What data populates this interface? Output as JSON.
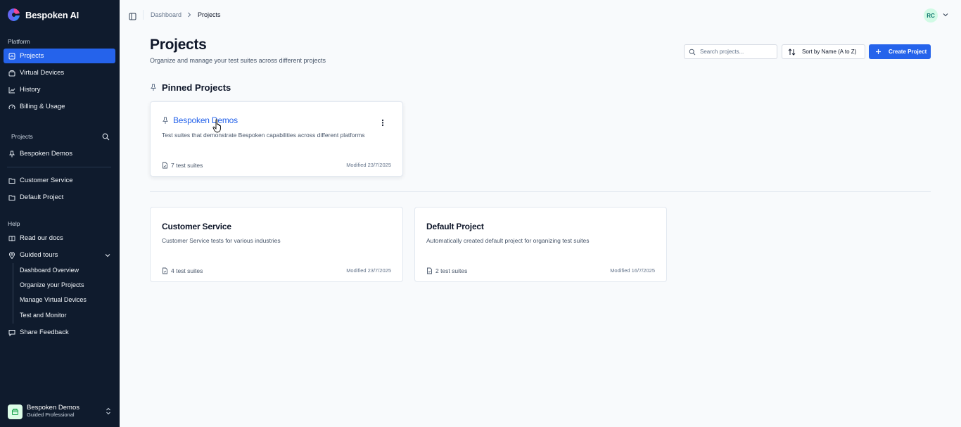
{
  "brand": {
    "name": "Bespoken AI"
  },
  "sidebar": {
    "platform_label": "Platform",
    "platform_items": [
      {
        "label": "Projects",
        "icon": "projects-icon",
        "active": true
      },
      {
        "label": "Virtual Devices",
        "icon": "devices-icon"
      },
      {
        "label": "History",
        "icon": "chart-icon"
      },
      {
        "label": "Billing & Usage",
        "icon": "gauge-icon"
      }
    ],
    "projects_label": "Projects",
    "pinned_projects": [
      {
        "label": "Bespoken Demos",
        "icon": "pin-icon"
      }
    ],
    "projects": [
      {
        "label": "Customer Service",
        "icon": "folder-icon"
      },
      {
        "label": "Default Project",
        "icon": "folder-icon"
      }
    ],
    "help_label": "Help",
    "help_items": [
      {
        "label": "Read our docs",
        "icon": "book-icon"
      },
      {
        "label": "Guided tours",
        "icon": "map-pin-icon"
      }
    ],
    "tours": [
      "Dashboard Overview",
      "Organize your Projects",
      "Manage Virtual Devices",
      "Test and Monitor"
    ],
    "feedback": {
      "label": "Share Feedback",
      "icon": "message-icon"
    },
    "account": {
      "name": "Bespoken Demos",
      "plan": "Guided Professional"
    }
  },
  "topbar": {
    "breadcrumb": [
      "Dashboard",
      "Projects"
    ],
    "user_initials": "RC"
  },
  "header": {
    "title": "Projects",
    "subtitle": "Organize and manage your test suites across different projects",
    "search_placeholder": "Search projects...",
    "sort_label": "Sort by Name (A to Z)",
    "create_label": "Create Project"
  },
  "pinned": {
    "title": "Pinned Projects",
    "cards": [
      {
        "name": "Bespoken Demos",
        "description": "Test suites that demonstrate Bespoken capabilities across different platforms",
        "suites": "7 test suites",
        "modified": "Modified 23/7/2025"
      }
    ]
  },
  "projects": [
    {
      "name": "Customer Service",
      "description": "Customer Service tests for various industries",
      "suites": "4 test suites",
      "modified": "Modified 23/7/2025"
    },
    {
      "name": "Default Project",
      "description": "Automatically created default project for organizing test suites",
      "suites": "2 test suites",
      "modified": "Modified 16/7/2025"
    }
  ],
  "colors": {
    "sidebar_bg": "#0f1b2d",
    "accent": "#2563eb",
    "page_bg": "#f8fafc"
  }
}
